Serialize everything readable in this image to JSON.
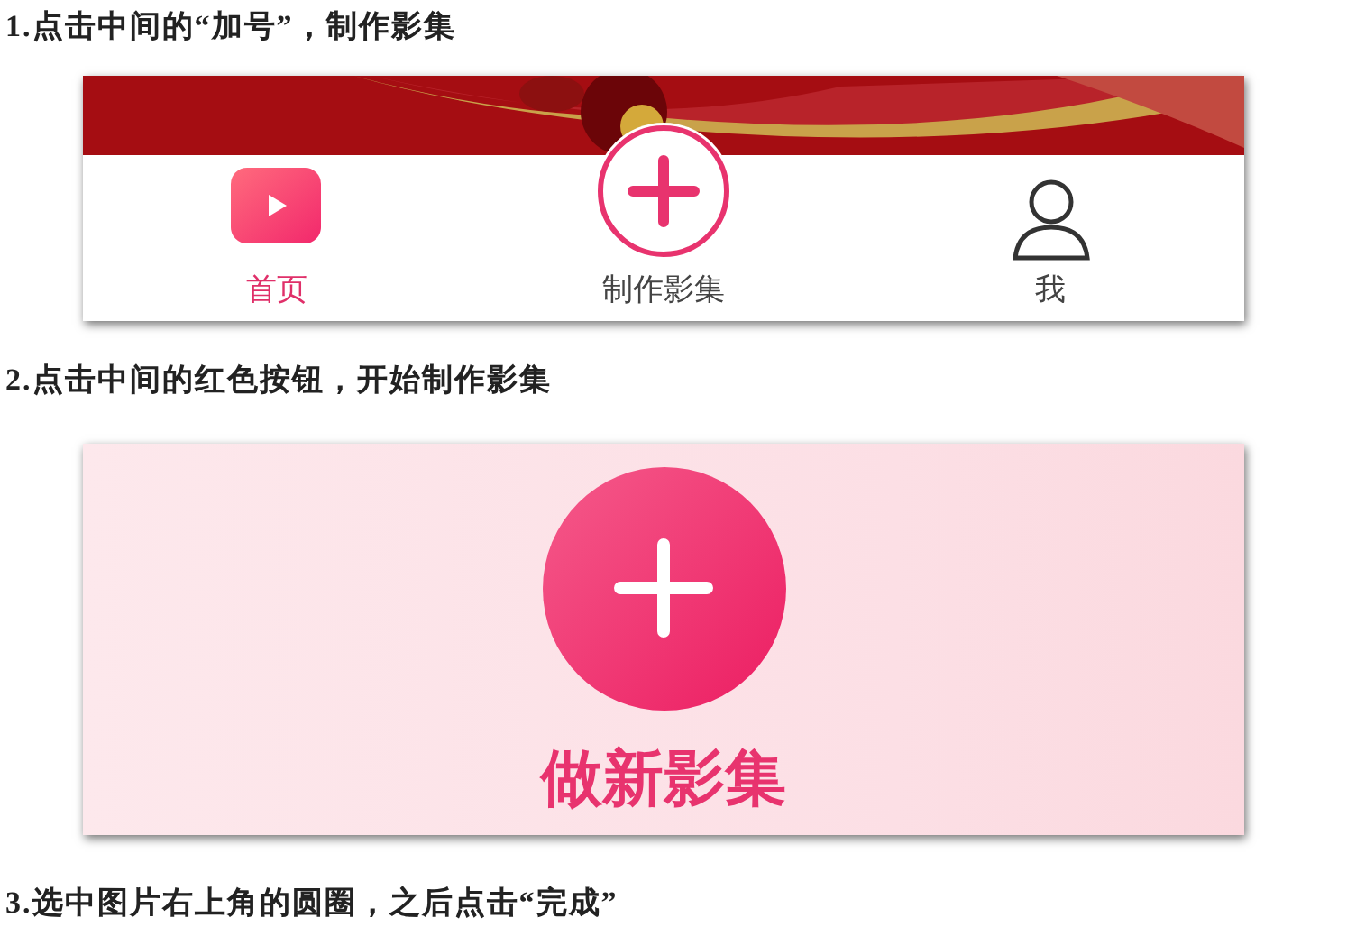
{
  "steps": [
    {
      "heading": "1.点击中间的“加号”，制作影集",
      "kind": "tabbar",
      "tabs": [
        {
          "label": "首页",
          "kind": "home",
          "selected": true
        },
        {
          "label": "制作影集",
          "kind": "create",
          "selected": false
        },
        {
          "label": "我",
          "kind": "profile",
          "selected": false
        }
      ]
    },
    {
      "heading": "2.点击中间的红色按钮，开始制作影集",
      "kind": "create",
      "button_label": "做新影集"
    },
    {
      "heading": "3.选中图片右上角的圆圈，之后点击“完成”",
      "kind": "text"
    }
  ]
}
